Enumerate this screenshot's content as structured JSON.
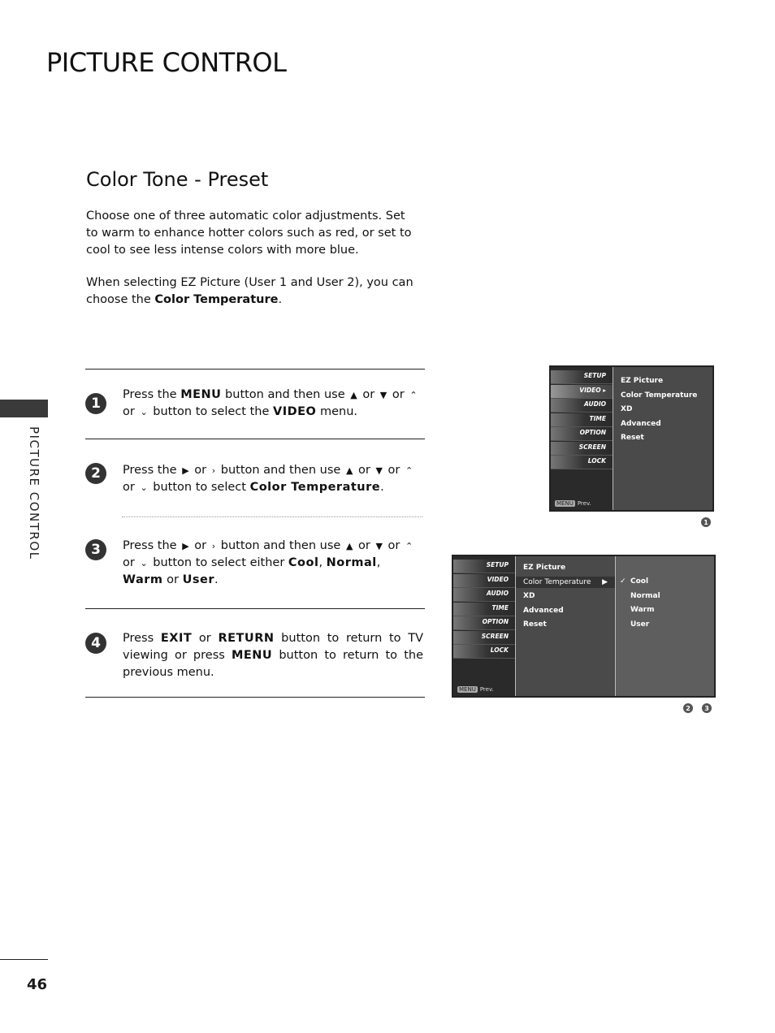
{
  "page": {
    "title": "PICTURE CONTROL",
    "side_label": "PICTURE CONTROL",
    "page_number": "46"
  },
  "section": {
    "title": "Color Tone - Preset",
    "intro_1": "Choose one of three automatic color adjustments. Set to warm to enhance hotter colors such as red, or set to cool to see less intense colors with more blue.",
    "intro_2_prefix": "When selecting EZ Picture (User 1 and User 2), you can choose the ",
    "intro_2_keyword": "Color Temperature",
    "intro_2_suffix": "."
  },
  "steps": [
    {
      "number": "1",
      "parts": [
        "Press the ",
        "MENU",
        " button and then use ",
        "▲",
        " or ",
        "▼",
        "  or ",
        "⌃",
        " or ",
        "⌄",
        "  button to select the ",
        "VIDEO",
        " menu."
      ]
    },
    {
      "number": "2",
      "parts": [
        "Press the ",
        "▶",
        "  or ",
        "›",
        "  button and then use ",
        "▲",
        " or ",
        "▼",
        "  or ",
        "⌃",
        " or ",
        "⌄",
        "  button to select ",
        "Color Temperature",
        "."
      ]
    },
    {
      "number": "3",
      "parts": [
        "Press the ",
        "▶",
        "  or ",
        "›",
        "  button and then use ",
        "▲",
        " or ",
        "▼",
        "  or ",
        "⌃",
        " or ",
        "⌄",
        "  button to select either ",
        "Cool",
        ", ",
        "Normal",
        ", ",
        "Warm",
        " or ",
        "User",
        "."
      ]
    },
    {
      "number": "4",
      "parts": [
        "Press ",
        "EXIT",
        " or ",
        "RETURN",
        " button to return to TV viewing or press ",
        "MENU",
        " button to return to the previous menu."
      ]
    }
  ],
  "tv_menu": {
    "categories": [
      "SETUP",
      "VIDEO",
      "AUDIO",
      "TIME",
      "OPTION",
      "SCREEN",
      "LOCK"
    ],
    "selected_category": "VIDEO",
    "prev_key": "MENU",
    "prev_label": "Prev.",
    "video_options": [
      "EZ Picture",
      "Color Temperature",
      "XD",
      "Advanced",
      "Reset"
    ],
    "selected_option": "Color Temperature",
    "color_temp_options": [
      "Cool",
      "Normal",
      "Warm",
      "User"
    ],
    "checked_temp": "Cool",
    "check_mark": "✓",
    "submenu_arrow": "▶"
  },
  "callouts": {
    "screen1": [
      "1"
    ],
    "screen2": [
      "2",
      "3"
    ]
  }
}
